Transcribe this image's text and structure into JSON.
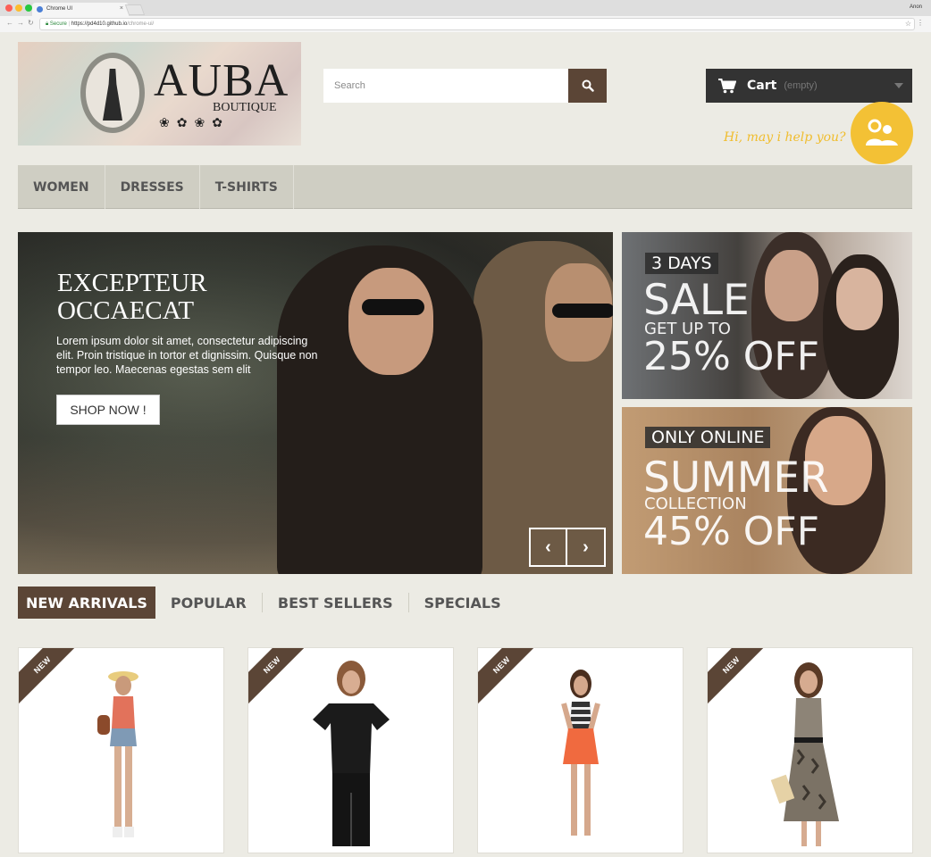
{
  "browser": {
    "tab_title": "Chrome UI",
    "user": "Anon",
    "url_secure": "Secure",
    "url_host": "https://pd4d10.github.io",
    "url_path": "/chrome-ui/"
  },
  "header": {
    "logo_text": "AUBA",
    "logo_sub": "BOUTIQUE",
    "search_placeholder": "Search",
    "cart_label": "Cart",
    "cart_status": "(empty)",
    "help_text": "Hi, may i help you?"
  },
  "menu": [
    {
      "label": "WOMEN"
    },
    {
      "label": "DRESSES"
    },
    {
      "label": "T-SHIRTS"
    }
  ],
  "hero": {
    "title_line1": "EXCEPTEUR",
    "title_line2": "OCCAECAT",
    "text": "Lorem ipsum dolor sit amet, consectetur adipiscing elit. Proin tristique in tortor et dignissim. Quisque non tempor leo. Maecenas egestas sem elit",
    "button": "SHOP NOW !",
    "prev": "‹",
    "next": "›"
  },
  "banners": [
    {
      "tag": "3 DAYS",
      "big": "SALE",
      "mid": "GET UP TO",
      "pct": "25% OFF"
    },
    {
      "tag": "ONLY ONLINE",
      "big": "SUMMER",
      "mid": "COLLECTION",
      "pct": "45% OFF"
    }
  ],
  "product_tabs": [
    {
      "label": "NEW ARRIVALS",
      "active": true
    },
    {
      "label": "POPULAR",
      "active": false
    },
    {
      "label": "BEST SELLERS",
      "active": false
    },
    {
      "label": "SPECIALS",
      "active": false
    }
  ],
  "products": [
    {
      "badge": "NEW"
    },
    {
      "badge": "NEW"
    },
    {
      "badge": "NEW"
    },
    {
      "badge": "NEW"
    }
  ],
  "colors": {
    "accent_brown": "#5b4536",
    "help_yellow": "#f3c135",
    "cart_dark": "#333333",
    "menu_bg": "#cfcec3"
  }
}
